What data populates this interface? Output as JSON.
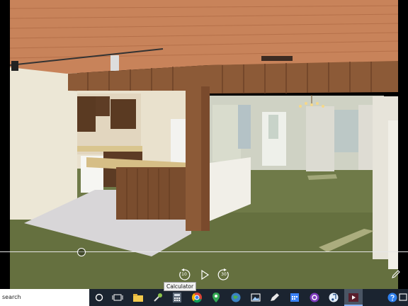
{
  "viewer": {
    "playback_progress": 0.19,
    "controls": {
      "rewind_seconds": "10",
      "forward_seconds": "30"
    }
  },
  "tooltip": {
    "text": "Calculator"
  },
  "taskbar": {
    "search_text": "search",
    "apps": [
      "task-view-icon",
      "file-explorer-icon",
      "tool-icon",
      "calculator-icon",
      "chrome-icon",
      "maps-icon",
      "globe-icon",
      "photos-icon",
      "edit-icon",
      "calendar-icon",
      "cortana-icon",
      "music-icon",
      "media-player-icon",
      "help-icon"
    ],
    "active_app": "media-player-icon"
  },
  "colors": {
    "taskbar": "#1b2430",
    "ceiling_wood": "#c8835a",
    "carpet": "#6f7a48"
  }
}
